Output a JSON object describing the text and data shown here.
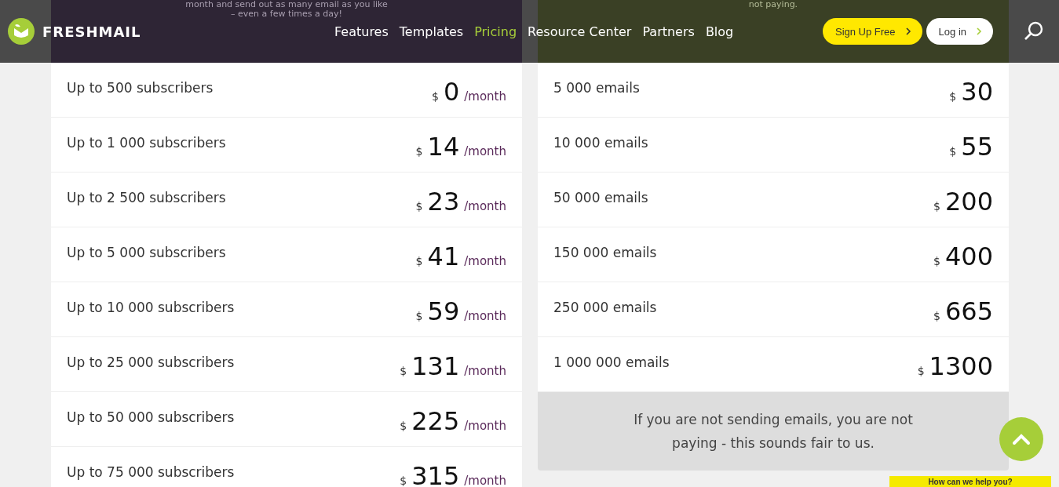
{
  "header": {
    "logo": "FRESHMAIL",
    "nav": [
      {
        "label": "Features",
        "selected": false
      },
      {
        "label": "Templates",
        "selected": false
      },
      {
        "label": "Pricing",
        "selected": true
      },
      {
        "label": "Resource Center",
        "selected": false
      },
      {
        "label": "Partners",
        "selected": false
      },
      {
        "label": "Blog",
        "selected": false
      }
    ],
    "signup": "Sign Up Free",
    "login": "Log in"
  },
  "plans": [
    {
      "intro": [
        "month and send out as many email as you like",
        "– even a few times a day!"
      ],
      "rows": [
        {
          "label": "Up to 500 subscribers",
          "currency": "$",
          "price": "0",
          "period": "/month"
        },
        {
          "label": "Up to 1 000 subscribers",
          "currency": "$",
          "price": "14",
          "period": "/month"
        },
        {
          "label": "Up to 2 500 subscribers",
          "currency": "$",
          "price": "23",
          "period": "/month"
        },
        {
          "label": "Up to 5 000 subscribers",
          "currency": "$",
          "price": "41",
          "period": "/month"
        },
        {
          "label": "Up to 10 000 subscribers",
          "currency": "$",
          "price": "59",
          "period": "/month"
        },
        {
          "label": "Up to 25 000 subscribers",
          "currency": "$",
          "price": "131",
          "period": "/month"
        },
        {
          "label": "Up to 50 000 subscribers",
          "currency": "$",
          "price": "225",
          "period": "/month"
        },
        {
          "label": "Up to 75 000 subscribers",
          "currency": "$",
          "price": "315",
          "period": "/month"
        }
      ]
    },
    {
      "intro": [
        "not paying."
      ],
      "rows": [
        {
          "label": "5 000 emails",
          "currency": "$",
          "price": "30"
        },
        {
          "label": "10 000 emails",
          "currency": "$",
          "price": "55"
        },
        {
          "label": "50 000 emails",
          "currency": "$",
          "price": "200"
        },
        {
          "label": "150 000 emails",
          "currency": "$",
          "price": "400"
        },
        {
          "label": "250 000 emails",
          "currency": "$",
          "price": "665"
        },
        {
          "label": "1 000 000 emails",
          "currency": "$",
          "price": "1300"
        }
      ],
      "note": "If you are not sending emails, you are not paying - this sounds fair to us."
    }
  ],
  "chat": {
    "label": "How can we help you?"
  }
}
